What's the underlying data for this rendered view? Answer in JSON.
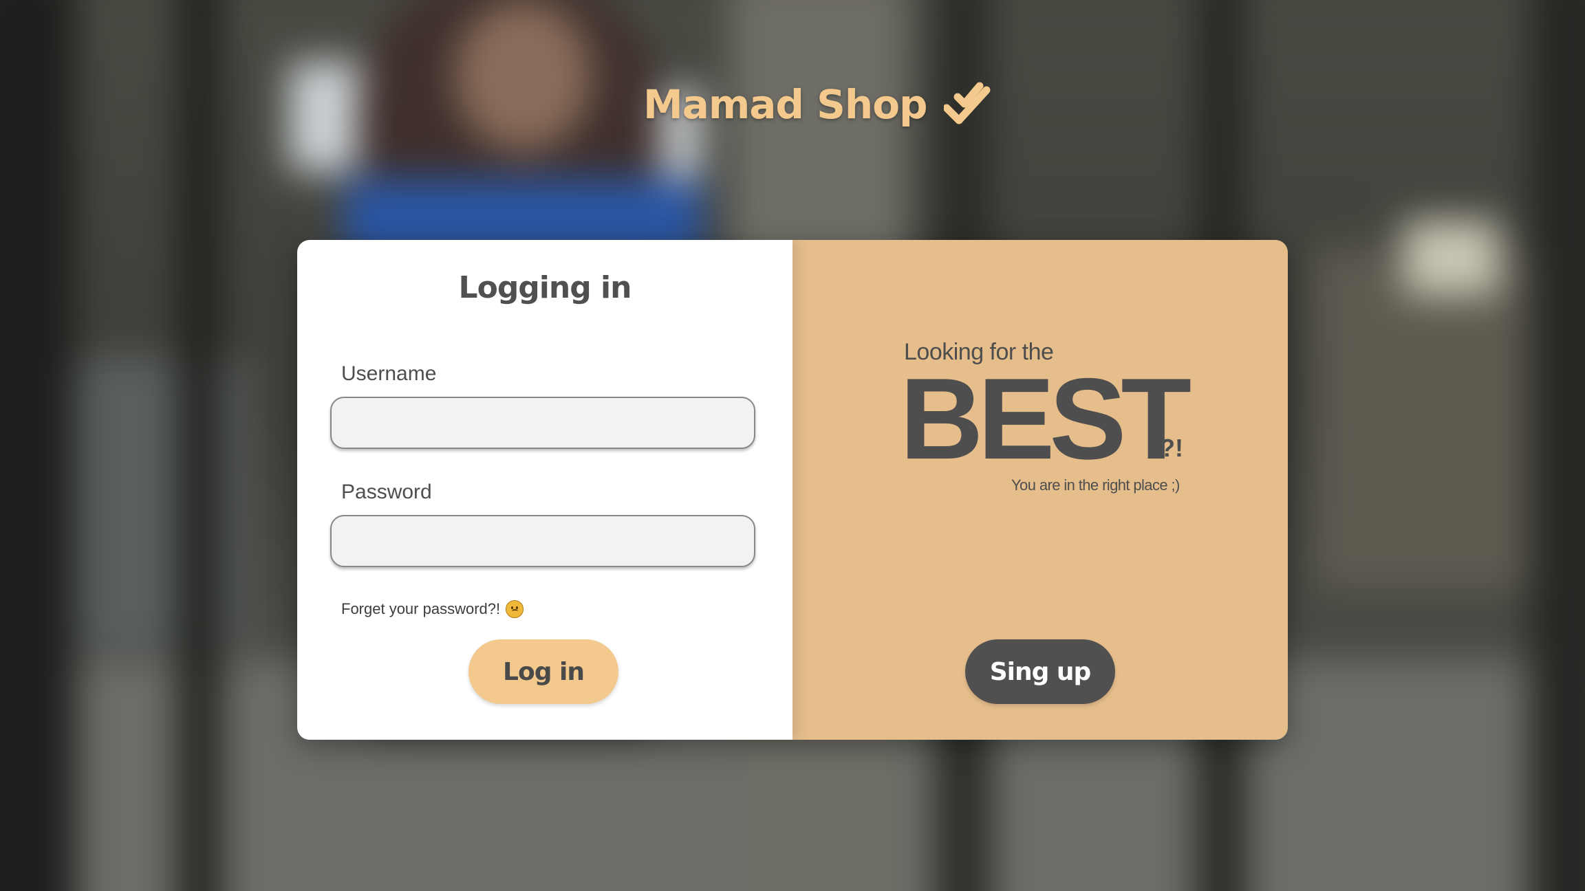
{
  "brand": {
    "name": "Mamad Shop",
    "icon": "double-check-icon",
    "color": "#f3c98d"
  },
  "login": {
    "title": "Logging in",
    "username_label": "Username",
    "username_value": "",
    "password_label": "Password",
    "password_value": "",
    "forgot_text": "Forget your password?!",
    "forgot_icon": "sad-face-emoji-icon",
    "login_button": "Log in"
  },
  "promo": {
    "line1": "Looking for the",
    "headline": "BEST",
    "mark": "?!",
    "subline": "You are in the right place ;)",
    "signup_button": "Sing up"
  },
  "colors": {
    "accent": "#f3c98d",
    "panel": "#e6be8c",
    "dark": "#505050"
  }
}
